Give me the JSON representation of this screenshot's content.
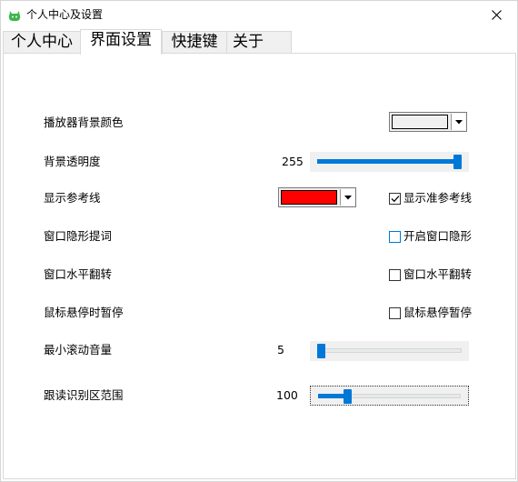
{
  "window": {
    "title": "个人中心及设置"
  },
  "tabs": [
    {
      "label": "个人中心"
    },
    {
      "label": "界面设置"
    },
    {
      "label": "快捷键"
    },
    {
      "label": "关于"
    }
  ],
  "active_tab": "界面设置",
  "settings": {
    "bg_color": {
      "label": "播放器背景颜色",
      "color": "#f0f0f0"
    },
    "opacity": {
      "label": "背景透明度",
      "value": "255",
      "fraction": 1.0
    },
    "ref_line": {
      "label": "显示参考线",
      "color": "#ff0000",
      "checkbox_label": "显示准参考线",
      "checked": true
    },
    "hide_tip": {
      "label": "窗口隐形提词",
      "checkbox_label": "开启窗口隐形",
      "checked": false
    },
    "flip": {
      "label": "窗口水平翻转",
      "checkbox_label": "窗口水平翻转",
      "checked": false
    },
    "hover_pause": {
      "label": "鼠标悬停时暂停",
      "checkbox_label": "鼠标悬停暂停",
      "checked": false
    },
    "min_volume": {
      "label": "最小滚动音量",
      "value": "5",
      "fraction": 0.0
    },
    "recognition": {
      "label": "跟读识别区范围",
      "value": "100",
      "fraction": 0.19
    }
  },
  "accent_color": "#0078d7"
}
